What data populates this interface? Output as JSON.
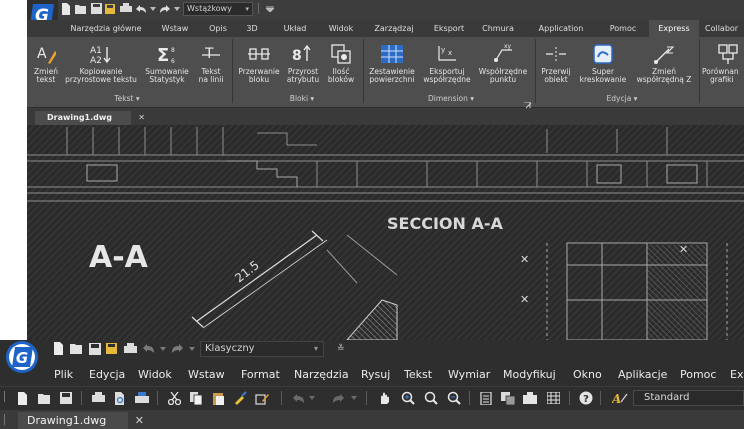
{
  "ribbon_window": {
    "workspace": "Wstążkowy",
    "tabs": [
      "Narzędzia główne",
      "Wstaw",
      "Opis",
      "3D",
      "Układ",
      "Widok",
      "Zarządzaj",
      "Eksport",
      "Chmura",
      "Application",
      "Pomoc",
      "Express",
      "Collabor"
    ],
    "active_tab": "Express",
    "groups": {
      "tekst": {
        "label": "Tekst",
        "tools": [
          {
            "l1": "Zmień",
            "l2": "tekst"
          },
          {
            "l1": "Kopiowanie",
            "l2": "przyrostowe tekstu"
          },
          {
            "l1": "Sumowanie",
            "l2": "Statystyk"
          },
          {
            "l1": "Tekst",
            "l2": "na linii"
          }
        ]
      },
      "bloki": {
        "label": "Bloki",
        "tools": [
          {
            "l1": "Przerwanie",
            "l2": "bloku"
          },
          {
            "l1": "Przyrost",
            "l2": "atrybutu"
          },
          {
            "l1": "Ilość",
            "l2": "bloków"
          }
        ]
      },
      "dimension": {
        "label": "Dimension",
        "tools": [
          {
            "l1": "Zestawienie",
            "l2": "powierzchni"
          },
          {
            "l1": "Eksportuj",
            "l2": "współrzędne"
          },
          {
            "l1": "Współrzędne",
            "l2": "punktu"
          }
        ]
      },
      "edycja": {
        "label": "Edycja",
        "tools": [
          {
            "l1": "Przerwij",
            "l2": "obiekt"
          },
          {
            "l1": "Super",
            "l2": "kreskowanie"
          },
          {
            "l1": "Zmień",
            "l2": "współrzędną Z"
          }
        ]
      },
      "extra": {
        "tools": [
          {
            "l1": "Porównan",
            "l2": "grafiki"
          }
        ]
      }
    },
    "document_tab": "Drawing1.dwg",
    "drawing": {
      "title_left": "A-A",
      "title_center": "SECCION A-A",
      "dimension": "21.5"
    }
  },
  "classic_window": {
    "workspace": "Klasyczny",
    "menu": [
      "Plik",
      "Edycja",
      "Widok",
      "Wstaw",
      "Format",
      "Narzędzia",
      "Rysuj",
      "Tekst",
      "Wymiar",
      "Modyfikuj",
      "Okno",
      "Aplikacje",
      "Pomoc",
      "Ex"
    ],
    "text_style": "Standard",
    "document_tab": "Drawing1.dwg"
  },
  "colors": {
    "ribbon_bg": "#4e4e4e",
    "tab_bar": "#3a3a3a",
    "logo_blue": "#1e64c8",
    "canvas": "#2b2b2b",
    "classic_bg": "#2e2e2e"
  }
}
